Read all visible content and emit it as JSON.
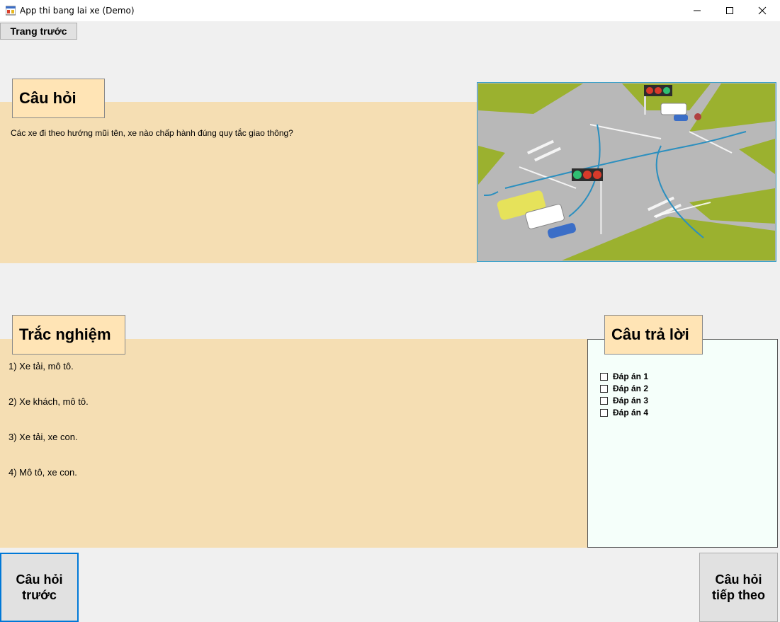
{
  "window": {
    "title": "App thi bang lai xe (Demo)",
    "icon": "app-window-icon",
    "controls": [
      "minimize-icon",
      "maximize-icon",
      "close-icon"
    ]
  },
  "toolbar": {
    "back_label": "Trang trước"
  },
  "question": {
    "header": "Câu hỏi",
    "text": "Các xe đi theo hướng mũi tên, xe nào chấp hành đúng quy tắc giao thông?",
    "image_alt": "intersection-illustration"
  },
  "choices": {
    "header": "Trắc nghiệm",
    "items": [
      "1) Xe tải, mô tô.",
      "2) Xe khách, mô tô.",
      "3) Xe tải, xe con.",
      "4) Mô tô, xe con."
    ]
  },
  "answer": {
    "header": "Câu trả lời",
    "options": [
      "Đáp án 1",
      "Đáp án 2",
      "Đáp án 3",
      "Đáp án 4"
    ],
    "checked": [
      false,
      false,
      false,
      false
    ]
  },
  "navigation": {
    "prev_line1": "Câu hỏi",
    "prev_line2": "trước",
    "next_line1": "Câu hỏi",
    "next_line2": "tiếp theo"
  },
  "colors": {
    "panel": "#f5deb3",
    "tag": "#ffe4b5",
    "answer_bg": "#f5fffa",
    "focus_border": "#0078d7",
    "grass": "#9bb12f",
    "road": "#b3b3b3"
  }
}
